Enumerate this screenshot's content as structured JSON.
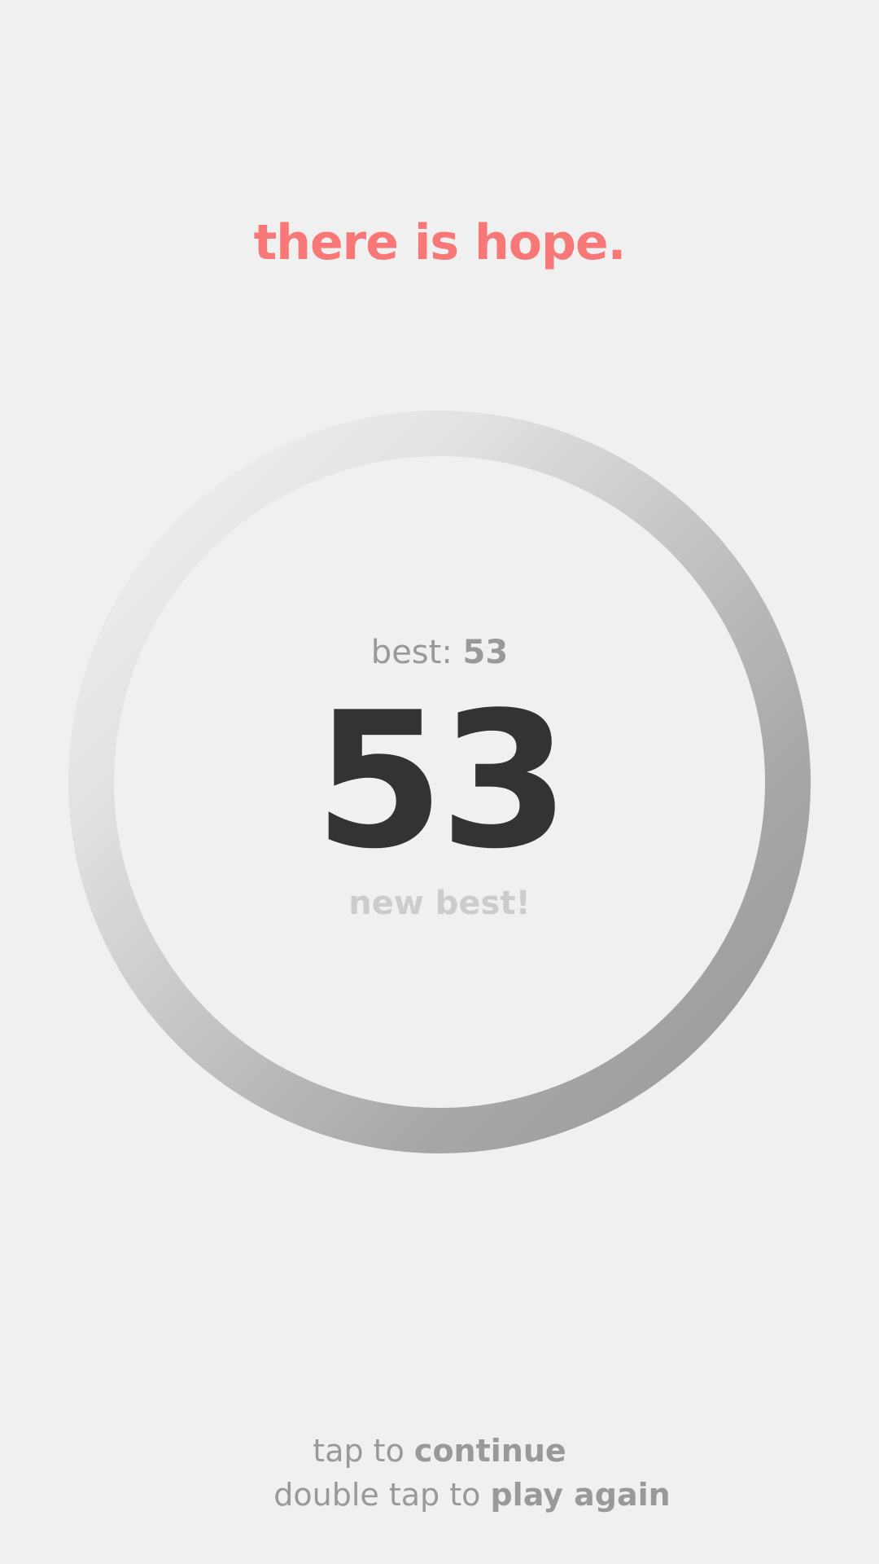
{
  "game": {
    "headline": "there is hope.",
    "best_label": "best:",
    "best_value": "53",
    "score": "53",
    "new_best": "new best!"
  },
  "instructions": {
    "continue_prefix": "tap to ",
    "continue_action": "continue",
    "replay_prefix": "double tap to ",
    "replay_action": "play again"
  },
  "colors": {
    "background": "#f0f0f0",
    "headline": "#f87878",
    "score": "#333333",
    "muted": "#999999",
    "new_best": "#cccccc"
  }
}
